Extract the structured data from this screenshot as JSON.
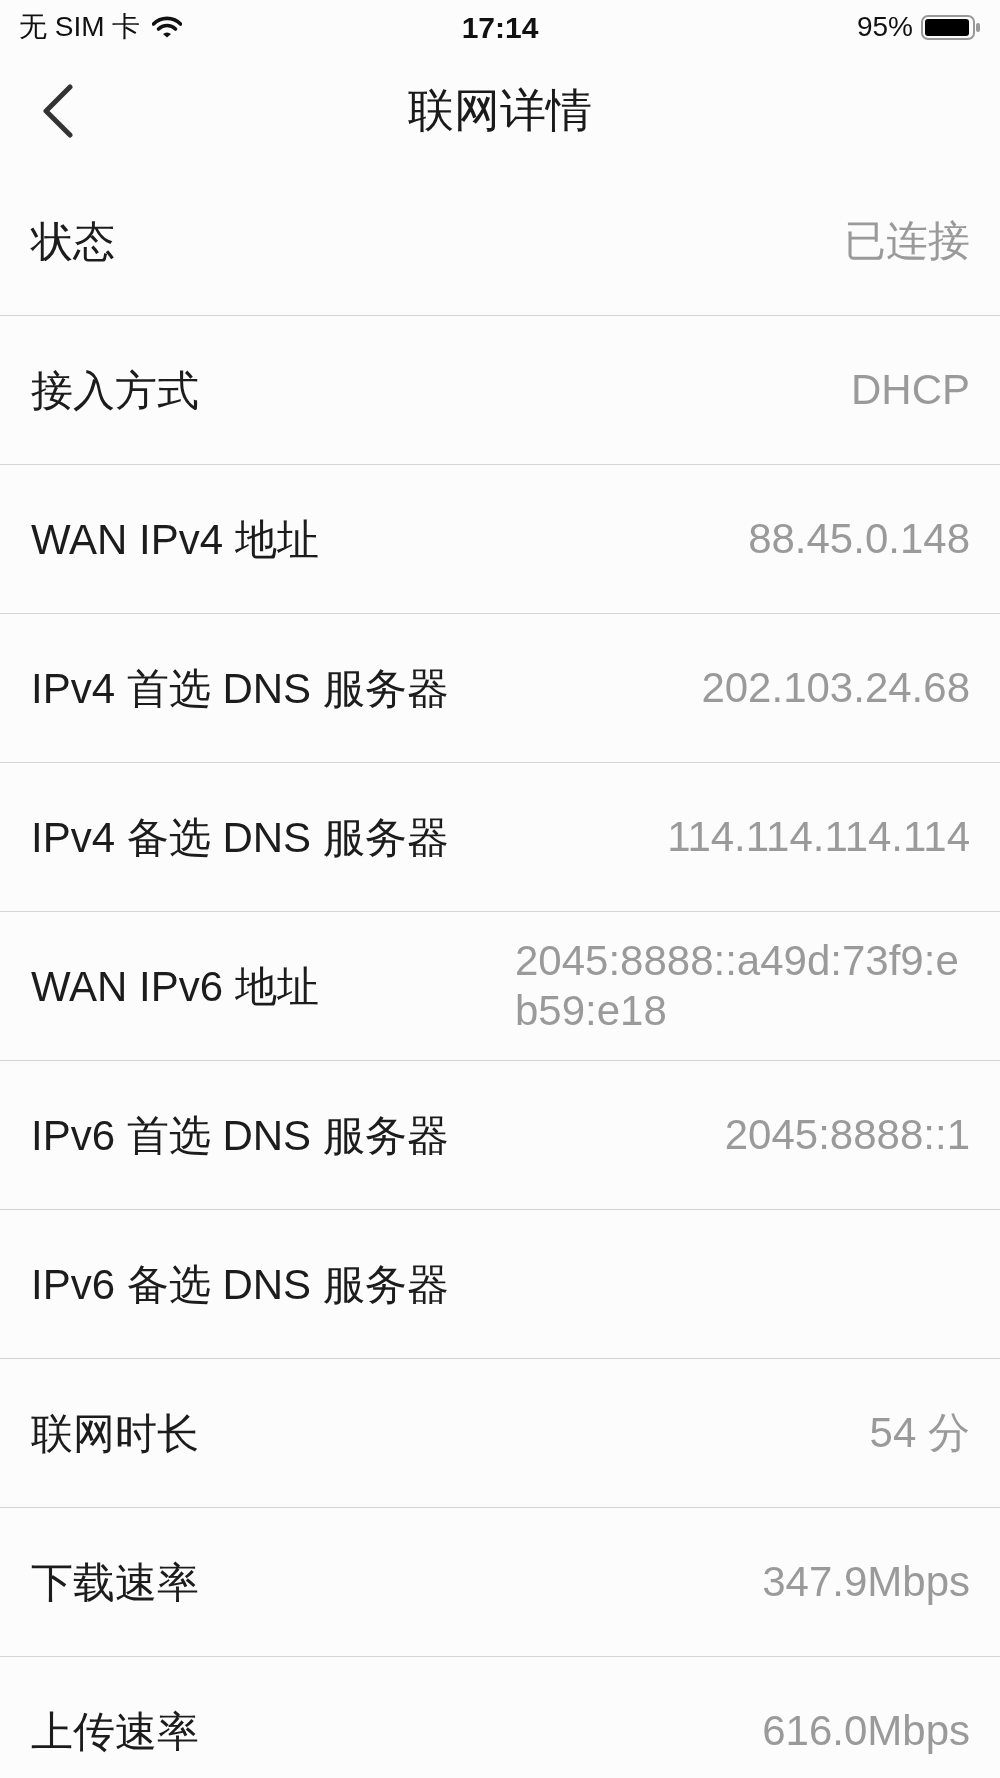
{
  "status_bar": {
    "carrier": "无 SIM 卡",
    "time": "17:14",
    "battery": "95%"
  },
  "nav_bar": {
    "title": "联网详情"
  },
  "rows": [
    {
      "label": "状态",
      "value": "已连接"
    },
    {
      "label": "接入方式",
      "value": "DHCP"
    },
    {
      "label": "WAN IPv4 地址",
      "value": "88.45.0.148"
    },
    {
      "label": "IPv4 首选 DNS 服务器",
      "value": "202.103.24.68"
    },
    {
      "label": "IPv4 备选 DNS 服务器",
      "value": "114.114.114.114"
    },
    {
      "label": "WAN IPv6 地址",
      "value": "2045:8888::a49d:73f9:eb59:e18"
    },
    {
      "label": "IPv6 首选 DNS 服务器",
      "value": "2045:8888::1"
    },
    {
      "label": "IPv6 备选 DNS 服务器"
    },
    {
      "label": "联网时长",
      "value": "54 分"
    },
    {
      "label": "下载速率",
      "value": "347.9Mbps"
    },
    {
      "label": "上传速率",
      "value": "616.0Mbps"
    }
  ]
}
